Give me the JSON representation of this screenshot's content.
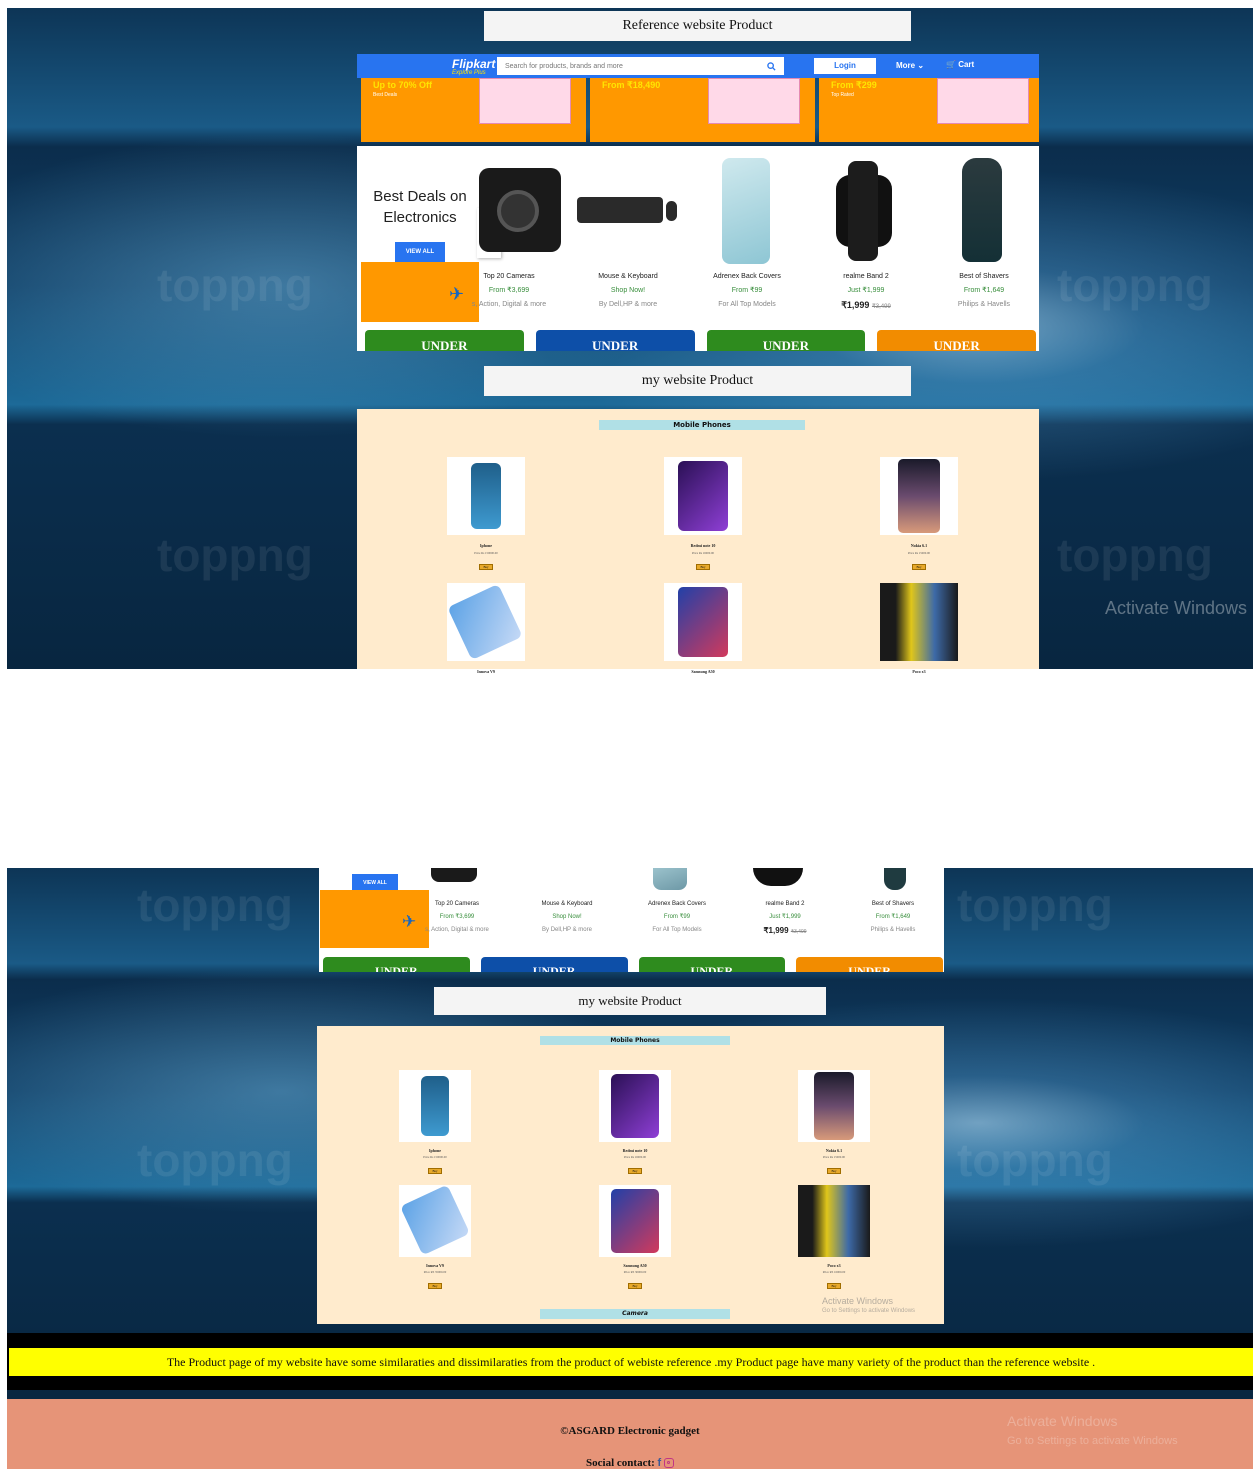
{
  "reference_caption": "Reference website Product",
  "my_caption": "my website Product",
  "flipkart": {
    "logo": "Flipkart",
    "logo_sub": "Explore Plus",
    "search_placeholder": "Search for products, brands and more",
    "login": "Login",
    "more": "More",
    "cart": "Cart",
    "banners": [
      {
        "title": "Up to 70% Off",
        "sub": "Best Deals"
      },
      {
        "title": "From ₹18,490",
        "sub": ""
      },
      {
        "title": "From ₹299",
        "sub": "Top Rated"
      }
    ],
    "deals_title": "Best Deals on Electronics",
    "view_all": "VIEW ALL",
    "items": [
      {
        "name": "Top 20 Cameras",
        "price": "From ₹3,699",
        "sub": "s, Action, Digital & more"
      },
      {
        "name": "Mouse & Keyboard",
        "price": "Shop Now!",
        "sub": "By Dell,HP & more"
      },
      {
        "name": "Adrenex Back Covers",
        "price": "From ₹99",
        "sub": "For All Top Models"
      },
      {
        "name": "realme Band 2",
        "price": "Just ₹1,999",
        "sub": "₹1,999",
        "strike": "₹3,499"
      },
      {
        "name": "Best of Shavers",
        "price": "From ₹1,649",
        "sub": "Philips & Havells"
      }
    ],
    "under_label": "UNDER",
    "under_colors": [
      "#2e8b1e",
      "#0d4fa8",
      "#2e8b1e",
      "#f28c00"
    ]
  },
  "mysite": {
    "mobile_heading": "Mobile Phones",
    "camera_heading": "Camera",
    "buy": "Buy",
    "products": [
      {
        "name": "Iphone",
        "price": "Price Rs 150000.00"
      },
      {
        "name": "Redmi note 10",
        "price": "Price Rs 16000.00"
      },
      {
        "name": "Nokia 6.1",
        "price": "Price Rs 15000.00"
      },
      {
        "name": "Innova V9",
        "price": "Price RS 35000.00"
      },
      {
        "name": "Samsung A50",
        "price": "Price RS 30000.00"
      },
      {
        "name": "Poco x3",
        "price": "Price RS 16000.00"
      }
    ]
  },
  "activate": {
    "title": "Activate Windows",
    "sub": "Go to Settings to activate Windows"
  },
  "watermark": "toppng",
  "info_text": "The Product page of my website have some similaraties and dissimilaraties from the product of webiste reference .my Product page have many variety of the product than the reference website .",
  "footer": {
    "copyright": "©ASGARD Electronic gadget",
    "social": "Social contact:",
    "icons": [
      "facebook-icon",
      "instagram-icon"
    ]
  }
}
